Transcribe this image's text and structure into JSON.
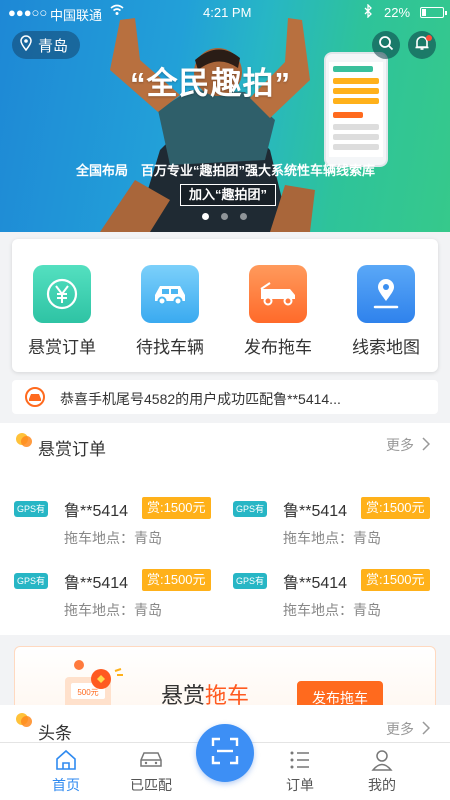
{
  "status_bar": {
    "signal": "●●●○○",
    "carrier": "中国联通",
    "time": "4:21 PM",
    "battery": "22%",
    "battery_level": 0.22
  },
  "header": {
    "city": "青岛"
  },
  "banner": {
    "title": "“全民趣拍”",
    "subtitle": "全国布局　百万专业“趣拍团”强大系统性车辆线索库",
    "cta": "加入“趣拍团”",
    "slide_count": 3,
    "active_slide": 0
  },
  "quick_menu": [
    {
      "label": "悬赏订单",
      "icon": "yuan-coin-icon",
      "color": "#3fcfb1"
    },
    {
      "label": "待找车辆",
      "icon": "car-icon",
      "color": "#4bb6f2"
    },
    {
      "label": "发布拖车",
      "icon": "tow-truck-icon",
      "color": "#ff7a3d"
    },
    {
      "label": "线索地图",
      "icon": "map-pin-icon",
      "color": "#3b8ff0"
    }
  ],
  "notice": {
    "text": "恭喜手机尾号4582的用户成功匹配鲁**5414..."
  },
  "orders_section": {
    "title": "悬赏订单",
    "more": "更多",
    "items": [
      {
        "gps": "GPS有",
        "plate": "鲁**5414",
        "reward": "赏:1500元",
        "location": "拖车地点：青岛"
      },
      {
        "gps": "GPS有",
        "plate": "鲁**5414",
        "reward": "赏:1500元",
        "location": "拖车地点：青岛"
      },
      {
        "gps": "GPS有",
        "plate": "鲁**5414",
        "reward": "赏:1500元",
        "location": "拖车地点：青岛"
      },
      {
        "gps": "GPS有",
        "plate": "鲁**5414",
        "reward": "赏:1500元",
        "location": "拖车地点：青岛"
      }
    ]
  },
  "promo": {
    "title_a": "悬赏",
    "title_b": "拖车",
    "button": "发布拖车",
    "coupon_amount": "500元"
  },
  "news_section": {
    "title": "头条",
    "more": "更多"
  },
  "tabbar": [
    {
      "label": "首页",
      "icon": "home-icon",
      "active": true
    },
    {
      "label": "已匹配",
      "icon": "car-outline-icon",
      "active": false
    },
    {
      "label": "订单",
      "icon": "list-icon",
      "active": false
    },
    {
      "label": "我的",
      "icon": "user-icon",
      "active": false
    }
  ],
  "colors": {
    "accent": "#2f8af0",
    "reward": "#ffb11a",
    "gps": "#27b6c5",
    "promo": "#ff6a1e"
  }
}
